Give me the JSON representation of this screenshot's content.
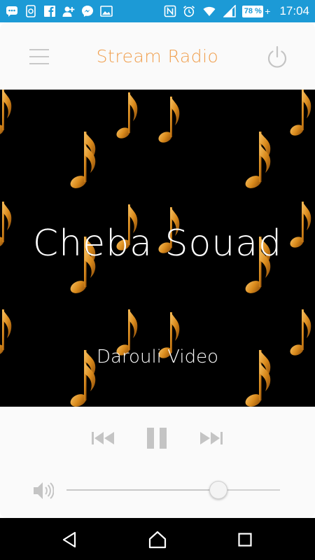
{
  "status_bar": {
    "time": "17:04",
    "battery_percent": "78 %",
    "icons_left": [
      "chat-icon",
      "photo-message-icon",
      "facebook-icon",
      "add-contact-icon",
      "messenger-icon",
      "gallery-icon"
    ],
    "icons_right": [
      "nfc-icon",
      "alarm-icon",
      "wifi-icon",
      "signal-icon",
      "battery-icon"
    ]
  },
  "header": {
    "title": "Stream Radio",
    "menu_icon": "hamburger-menu-icon",
    "power_icon": "power-icon"
  },
  "now_playing": {
    "station_name": "Cheba Souad",
    "subtitle": "Darouli Video",
    "artwork": "music-notes-pattern"
  },
  "controls": {
    "previous_icon": "skip-previous-icon",
    "pause_icon": "pause-icon",
    "next_icon": "skip-next-icon",
    "volume_icon": "speaker-icon",
    "volume_level": 0.71
  },
  "nav_bar": {
    "back_icon": "back-icon",
    "home_icon": "home-icon",
    "recents_icon": "recents-icon"
  },
  "colors": {
    "status_bar": "#1c9ad6",
    "title_accent": "#f0a050",
    "artwork_background": "#000000",
    "note_gold": "#d98a1c",
    "control_gray": "#c4c4c4"
  }
}
